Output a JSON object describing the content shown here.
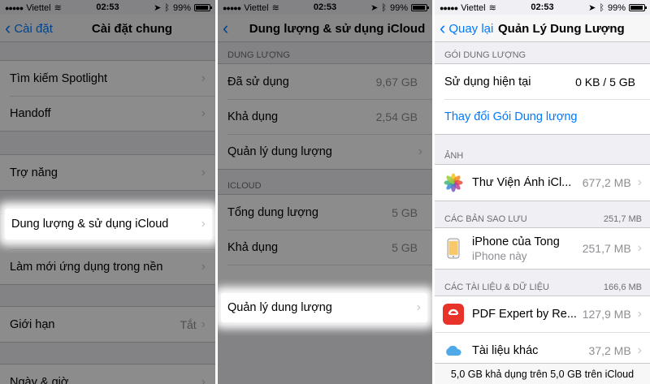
{
  "status": {
    "carrier": "Viettel",
    "time": "02:53",
    "battery": "99%"
  },
  "panel1": {
    "back_label": "Cài đặt",
    "title": "Cài đặt chung",
    "rows": [
      "Tìm kiếm Spotlight",
      "Handoff",
      "Trợ năng",
      "Dung lượng & sử dụng iCloud",
      "Làm mới ứng dụng trong nền",
      "Giới hạn",
      "Ngày & giờ"
    ],
    "limit_value": "Tắt"
  },
  "panel2": {
    "title": "Dung lượng & sử dụng iCloud",
    "storage_header": "DUNG LƯỢNG",
    "storage_rows": [
      {
        "label": "Đã sử dụng",
        "value": "9,67 GB"
      },
      {
        "label": "Khả dụng",
        "value": "2,54 GB"
      },
      {
        "label": "Quản lý dung lượng",
        "value": ""
      }
    ],
    "icloud_header": "ICLOUD",
    "icloud_rows": [
      {
        "label": "Tổng dung lượng",
        "value": "5 GB"
      },
      {
        "label": "Khả dụng",
        "value": "5 GB"
      },
      {
        "label": "Quản lý dung lượng",
        "value": ""
      }
    ]
  },
  "panel3": {
    "back_label": "Quay lại",
    "title": "Quản Lý Dung Lượng",
    "plan_header": "GÓI DUNG LƯỢNG",
    "current_usage_label": "Sử dụng hiện tại",
    "current_usage_value": "0 KB / 5 GB",
    "change_plan_label": "Thay đổi Gói Dung lượng",
    "photos_header": "ẢNH",
    "photos_label": "Thư Viện Ảnh iCl...",
    "photos_value": "677,2 MB",
    "backups_header": "CÁC BẢN SAO LƯU",
    "backups_total": "251,7 MB",
    "backup_name": "iPhone của Tong",
    "backup_sub": "iPhone này",
    "backup_value": "251,7 MB",
    "docs_header": "CÁC TÀI LIỆU & DỮ LIỆU",
    "docs_total": "166,6 MB",
    "docs_rows": [
      {
        "label": "PDF Expert by Re...",
        "value": "127,9 MB"
      },
      {
        "label": "Tài liệu khác",
        "value": "37,2 MB"
      }
    ],
    "footer": "5,0 GB khả dụng trên 5,0 GB trên iCloud"
  },
  "icons": [
    "wifi-icon",
    "location-icon",
    "bluetooth-icon",
    "battery-icon",
    "chevron-left-icon",
    "chevron-right-icon",
    "photos-icon",
    "iphone-icon",
    "pdf-expert-icon",
    "icloud-icon"
  ],
  "colors": {
    "ios_blue": "#007aff",
    "group_bg": "#efeff4",
    "secondary_text": "#8e8e93"
  }
}
